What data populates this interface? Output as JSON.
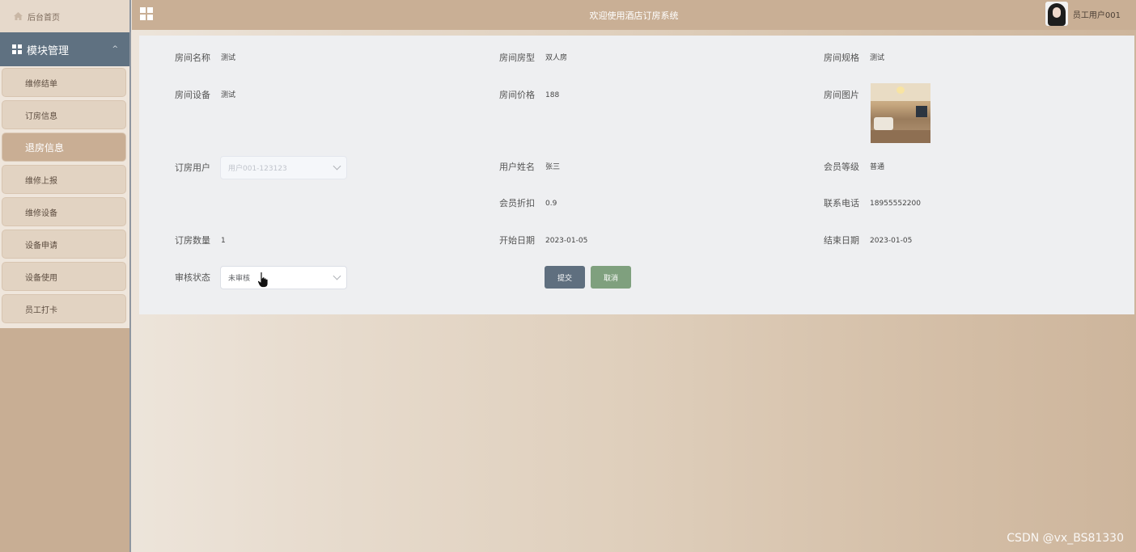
{
  "sidebar": {
    "home_label": "后台首页",
    "module_label": "模块管理",
    "items": [
      {
        "label": "维修结单",
        "active": false
      },
      {
        "label": "订房信息",
        "active": false
      },
      {
        "label": "退房信息",
        "active": true
      },
      {
        "label": "维修上报",
        "active": false
      },
      {
        "label": "维修设备",
        "active": false
      },
      {
        "label": "设备申请",
        "active": false
      },
      {
        "label": "设备使用",
        "active": false
      },
      {
        "label": "员工打卡",
        "active": false
      }
    ]
  },
  "header": {
    "title": "欢迎使用酒店订房系统",
    "username": "员工用户001"
  },
  "form": {
    "room_name": {
      "label": "房间名称",
      "value": "测试"
    },
    "room_type": {
      "label": "房间房型",
      "value": "双人房"
    },
    "room_spec": {
      "label": "房间规格",
      "value": "测试"
    },
    "room_equipment": {
      "label": "房间设备",
      "value": "测试"
    },
    "room_price": {
      "label": "房间价格",
      "value": "188"
    },
    "room_image": {
      "label": "房间图片"
    },
    "booking_user": {
      "label": "订房用户",
      "value": "用户001-123123"
    },
    "user_name": {
      "label": "用户姓名",
      "value": "张三"
    },
    "member_level": {
      "label": "会员等级",
      "value": "普通"
    },
    "member_discount": {
      "label": "会员折扣",
      "value": "0.9"
    },
    "phone": {
      "label": "联系电话",
      "value": "18955552200"
    },
    "booking_quantity": {
      "label": "订房数量",
      "value": "1"
    },
    "start_date": {
      "label": "开始日期",
      "value": "2023-01-05"
    },
    "end_date": {
      "label": "结束日期",
      "value": "2023-01-05"
    },
    "review_status": {
      "label": "审核状态",
      "value": "未审核"
    },
    "submit_label": "提交",
    "cancel_label": "取消"
  },
  "watermark": "CSDN @vx_BS81330"
}
